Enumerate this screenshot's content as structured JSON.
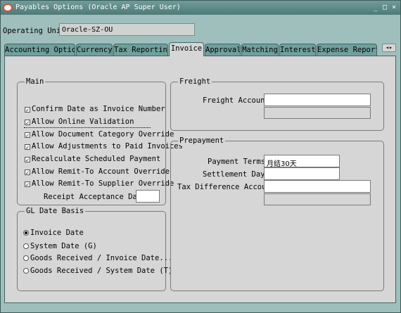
{
  "window": {
    "title": "Payables Options (Oracle AP Super User)",
    "buttons": [
      "_",
      "□",
      "×"
    ]
  },
  "operating_unit": {
    "label": "Operating Unit",
    "value": "Oracle-SZ-OU"
  },
  "tabs": [
    {
      "label": "Accounting Option",
      "active": false
    },
    {
      "label": "Currency",
      "active": false
    },
    {
      "label": "Tax Reporting",
      "active": false
    },
    {
      "label": "Invoice",
      "active": true
    },
    {
      "label": "Approval",
      "active": false
    },
    {
      "label": "Matching",
      "active": false
    },
    {
      "label": "Interest",
      "active": false
    },
    {
      "label": "Expense Report",
      "active": false
    }
  ],
  "tab_scroll_label": "◂▸",
  "main": {
    "title": "Main",
    "options": [
      {
        "label": "Confirm Date as Invoice Number",
        "checked": true
      },
      {
        "label": "Allow Online Validation",
        "checked": true
      },
      {
        "label": "Allow Document Category Override",
        "checked": true
      },
      {
        "label": "Allow Adjustments to Paid Invoices",
        "checked": true
      },
      {
        "label": "Recalculate Scheduled Payment",
        "checked": true
      },
      {
        "label": "Allow Remit-To Account Override",
        "checked": true
      },
      {
        "label": "Allow Remit-To Supplier Override",
        "checked": true
      }
    ],
    "receipt_acceptance_days_label": "Receipt Acceptance Days",
    "receipt_acceptance_days_value": ""
  },
  "gl_date_basis": {
    "title": "GL Date Basis",
    "options": [
      {
        "label": "Invoice Date",
        "selected": true
      },
      {
        "label": "System Date (G)",
        "selected": false
      },
      {
        "label": "Goods Received / Invoice Date...",
        "selected": false
      },
      {
        "label": "Goods Received / System Date (T)",
        "selected": false
      }
    ]
  },
  "freight": {
    "title": "Freight",
    "account_label": "Freight Account",
    "account_value": "",
    "account_desc": ""
  },
  "prepayment": {
    "title": "Prepayment",
    "payment_terms_label": "Payment Terms",
    "payment_terms_value": "月结30天",
    "settlement_days_label": "Settlement Days",
    "settlement_days_value": "",
    "tax_difference_account_label": "Tax Difference Account",
    "tax_difference_account_value": "",
    "tax_difference_account_desc": ""
  },
  "colors": {
    "window_bg": "#9fbfbd",
    "titlebar": "#5a8784",
    "tab_inactive": "#6fa09d",
    "panel_bg": "#d6d6d6"
  }
}
